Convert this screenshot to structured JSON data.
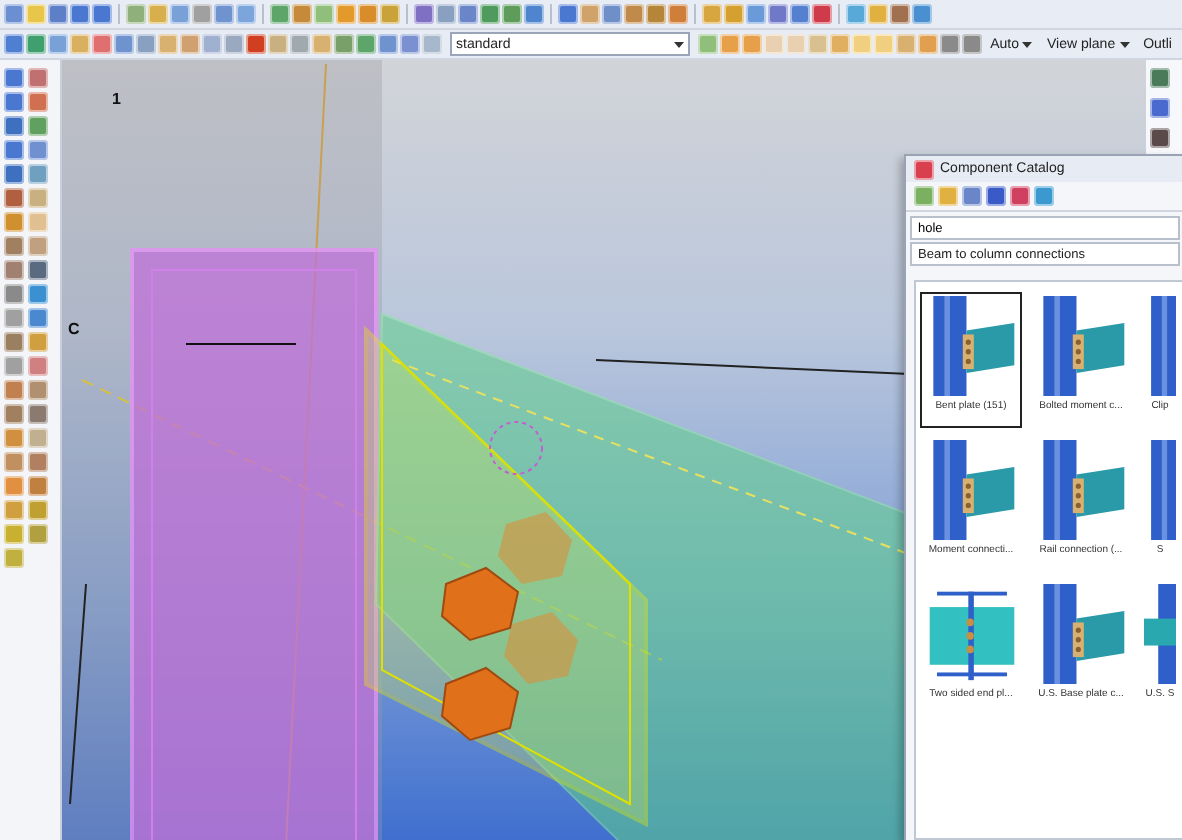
{
  "toolbar": {
    "view_style": "standard",
    "mode": "Auto",
    "plane": "View plane",
    "display": "Outli"
  },
  "viewport": {
    "grid_labels": [
      "1",
      "C"
    ]
  },
  "catalog": {
    "title": "Component Catalog",
    "search": "hole",
    "group": "Beam to column connections",
    "items": [
      {
        "label": "Bent plate (151)",
        "selected": true
      },
      {
        "label": "Bolted moment c...",
        "selected": false
      },
      {
        "label": "Clip",
        "selected": false
      },
      {
        "label": "Moment connecti...",
        "selected": false
      },
      {
        "label": "Rail connection (...",
        "selected": false
      },
      {
        "label": "S",
        "selected": false
      },
      {
        "label": "Two sided end pl...",
        "selected": false
      },
      {
        "label": "U.S. Base plate c...",
        "selected": false
      },
      {
        "label": "U.S. S",
        "selected": false
      }
    ]
  }
}
